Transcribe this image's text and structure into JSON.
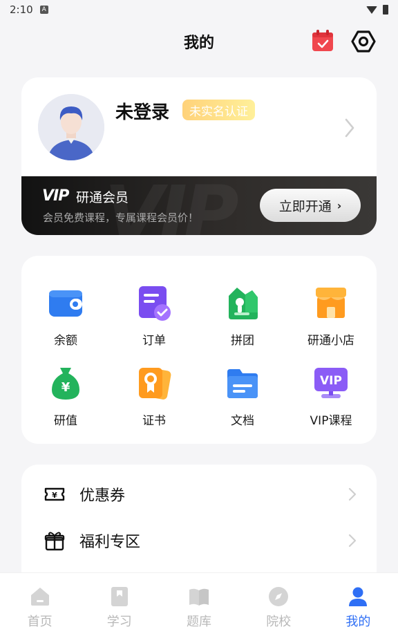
{
  "status_bar": {
    "time": "2:10",
    "notif_glyph": "A"
  },
  "header": {
    "title": "我的"
  },
  "profile": {
    "username": "未登录",
    "verify_badge": "未实名认证"
  },
  "vip": {
    "logo_text": "VIP",
    "title": "研通会员",
    "description": "会员免费课程，专属课程会员价！",
    "button_label": "立即开通",
    "button_chevron": "›"
  },
  "services": [
    {
      "label": "余额",
      "icon": "wallet-icon"
    },
    {
      "label": "订单",
      "icon": "order-icon"
    },
    {
      "label": "拼团",
      "icon": "group-buy-icon"
    },
    {
      "label": "研通小店",
      "icon": "shop-icon"
    },
    {
      "label": "研值",
      "icon": "money-bag-icon"
    },
    {
      "label": "证书",
      "icon": "certificate-icon"
    },
    {
      "label": "文档",
      "icon": "folder-icon"
    },
    {
      "label": "VIP课程",
      "icon": "vip-course-icon"
    }
  ],
  "list": [
    {
      "label": "优惠券",
      "icon": "coupon-icon"
    },
    {
      "label": "福利专区",
      "icon": "gift-icon"
    }
  ],
  "bottom_nav": [
    {
      "label": "首页",
      "icon": "home-icon",
      "active": false
    },
    {
      "label": "学习",
      "icon": "study-icon",
      "active": false
    },
    {
      "label": "题库",
      "icon": "question-bank-icon",
      "active": false
    },
    {
      "label": "院校",
      "icon": "compass-icon",
      "active": false
    },
    {
      "label": "我的",
      "icon": "profile-icon",
      "active": true
    }
  ],
  "colors": {
    "accent": "#2f6ff5",
    "page_bg": "#f5f5f7",
    "badge_gradient_start": "#ffd27a",
    "badge_gradient_end": "#fff09a",
    "calendar": "#f0474e",
    "nav_inactive": "#b8b8b8"
  }
}
